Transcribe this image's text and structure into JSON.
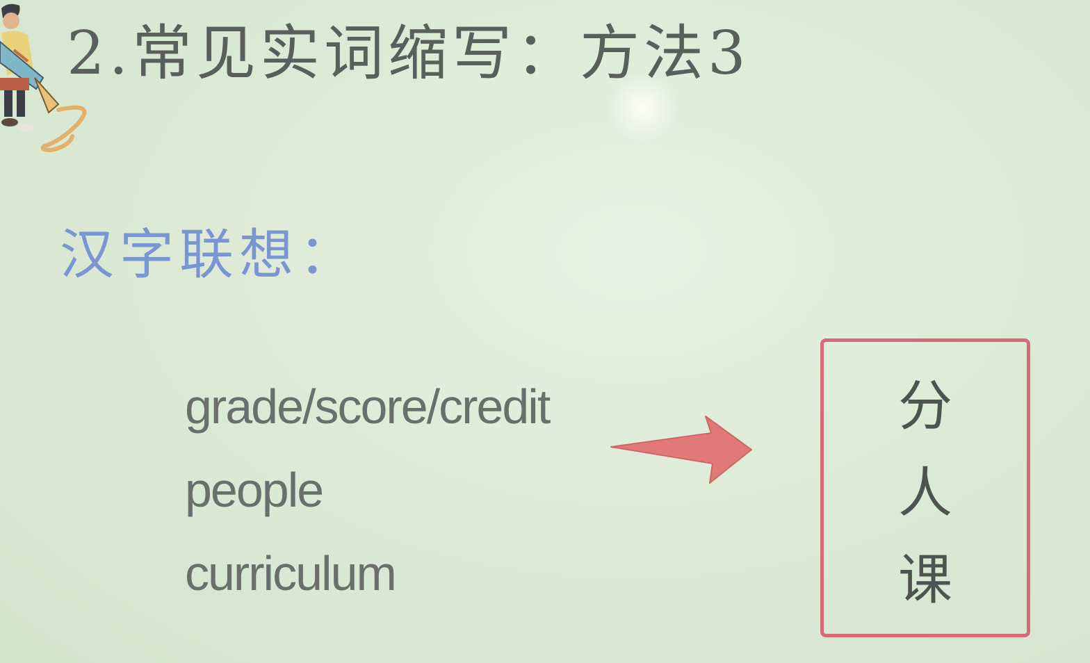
{
  "slide": {
    "title": "2.常见实词缩写：方法3",
    "section_label": "汉字联想：",
    "words": [
      "grade/score/credit",
      "people",
      "curriculum"
    ],
    "answers": [
      "分",
      "人",
      "课"
    ]
  },
  "colors": {
    "background": "#dcead6",
    "title_text": "#5a5f5c",
    "label_text": "#7b95d2",
    "word_text": "#6a6f6c",
    "arrow_fill": "#e07a78",
    "box_border": "#d86a78"
  },
  "icons": {
    "decoration": "person-with-scroll-illustration-icon",
    "arrow": "right-arrow-icon"
  }
}
